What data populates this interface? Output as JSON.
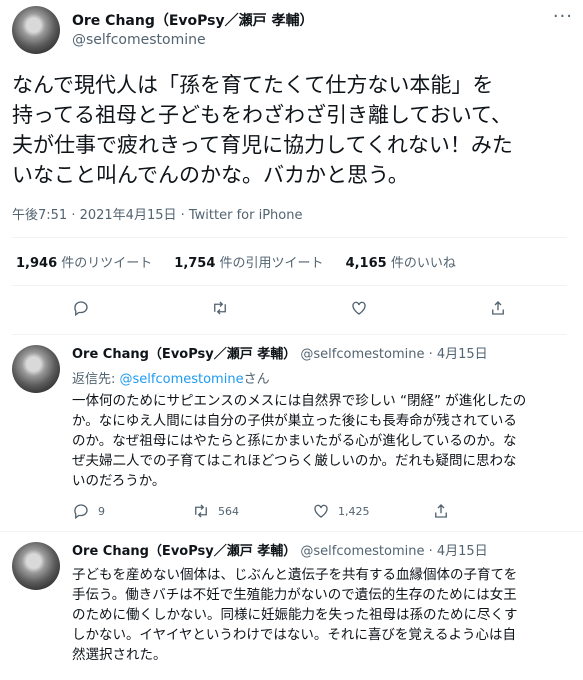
{
  "main_tweet": {
    "display_name": "Ore Chang（EvoPsy／瀬戸 孝輔）",
    "handle": "@selfcomestomine",
    "more_label": "···",
    "text": "なんで現代人は「孫を育てたくて仕方ない本能」を\n持ってる祖母と子どもをわざわざ引き離しておいて、\n夫が仕事で疲れきって育児に協力してくれない！みた\nいなこと叫んでんのかな。バカかと思う。",
    "timestamp": "午後7:51 · 2021年4月15日 · Twitter for iPhone",
    "stats": {
      "retweets_count": "1,946",
      "retweets_label": "件のリツイート",
      "quotes_count": "1,754",
      "quotes_label": "件の引用ツイート",
      "likes_count": "4,165",
      "likes_label": "件のいいね"
    }
  },
  "replies": [
    {
      "display_name": "Ore Chang（EvoPsy／瀬戸 孝輔）",
      "handle": "@selfcomestomine",
      "date": "· 4月15日",
      "reply_to_prefix": "返信先: ",
      "reply_to_handle": "@selfcomestomine",
      "reply_to_suffix": "さん",
      "text": "一体何のためにサピエンスのメスには自然界で珍しい “閉経” が進化したの\nか。なにゆえ人間には自分の子供が巣立った後にも長寿命が残されている\nのか。なぜ祖母にはやたらと孫にかまいたがる心が進化しているのか。な\nぜ夫婦二人での子育てはこれほどつらく厳しいのか。だれも疑問に思わな\nいのだろうか。",
      "reply_count": "9",
      "retweet_count": "564",
      "like_count": "1,425"
    },
    {
      "display_name": "Ore Chang（EvoPsy／瀬戸 孝輔）",
      "handle": "@selfcomestomine",
      "date": "· 4月15日",
      "text": "子どもを産めない個体は、じぶんと遺伝子を共有する血縁個体の子育てを\n手伝う。働きバチは不妊で生殖能力がないので遺伝的生存のためには女王\nのために働くしかない。同様に妊娠能力を失った祖母は孫のために尽くす\nしかない。イヤイヤというわけではない。それに喜びを覚えるよう心は自\n然選択された。"
    }
  ],
  "icons": [
    "reply-icon",
    "retweet-icon",
    "like-icon",
    "share-icon",
    "more-icon"
  ]
}
